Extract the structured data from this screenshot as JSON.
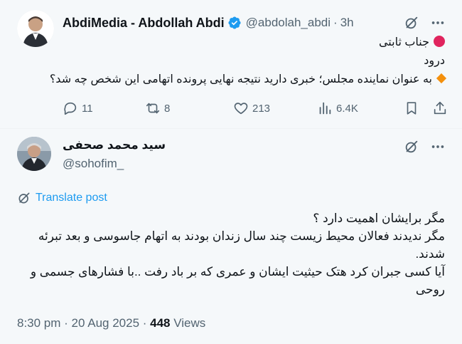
{
  "parent_tweet": {
    "display_name": "AbdiMedia - Abdollah Abdi",
    "handle": "@abdolah_abdi",
    "separator": "·",
    "time": "3h",
    "lines": [
      "جناب ثابتی",
      "درود",
      "به عنوان نماینده مجلس؛ خبری دارید نتیجه نهایی پرونده اتهامی این شخص چه شد؟"
    ],
    "actions": {
      "replies": "11",
      "retweets": "8",
      "likes": "213",
      "views": "6.4K"
    }
  },
  "reply_tweet": {
    "display_name": "سید محمد صحفی",
    "handle": "@sohofim_",
    "translate_label": "Translate post",
    "lines": [
      "مگر برایشان اهمیت دارد ؟",
      "مگر ندیدند فعالان محیط زیست چند سال زندان بودند به اتهام جاسوسی و بعد تبرئه شدند.",
      "آیا کسی جبران کرد هتک حیثیت ایشان و عمری که بر باد رفت ..با فشارهای جسمی و روحی"
    ],
    "timestamp": "8:30 pm · 20 Aug 2025 · ",
    "views_count": "448",
    "views_label": " Views"
  },
  "colors": {
    "accent": "#1d9bf0",
    "text": "#0f1419",
    "secondary": "#536471",
    "red_dot": "#e0245e",
    "diamond": "#f4900c"
  },
  "icons": {
    "verified": "verified-badge-icon",
    "grok": "grok-icon",
    "more": "more-icon",
    "reply": "reply-icon",
    "retweet": "retweet-icon",
    "like": "heart-icon",
    "views": "views-icon",
    "bookmark": "bookmark-icon",
    "share": "share-icon",
    "translate": "translate-icon"
  }
}
